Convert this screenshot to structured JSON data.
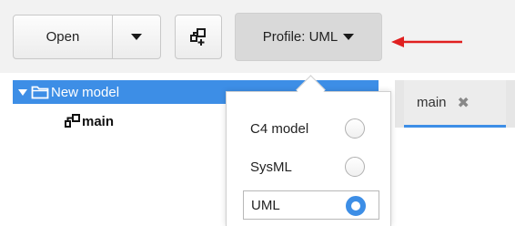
{
  "toolbar": {
    "open_label": "Open",
    "open_menu_icon": "chevron-down-icon",
    "new_diagram_icon": "new-diagram-icon",
    "profile_label": "Profile: UML",
    "accent": "#3d8ee6",
    "annotation_arrow_color": "#e02020"
  },
  "tree": {
    "root_label": "New model",
    "child_label": "main"
  },
  "tabs": [
    {
      "label": "main",
      "close_icon": "close-icon"
    }
  ],
  "profile_menu": {
    "options": [
      {
        "label": "C4 model",
        "selected": false
      },
      {
        "label": "SysML",
        "selected": false
      },
      {
        "label": "UML",
        "selected": true
      }
    ]
  }
}
